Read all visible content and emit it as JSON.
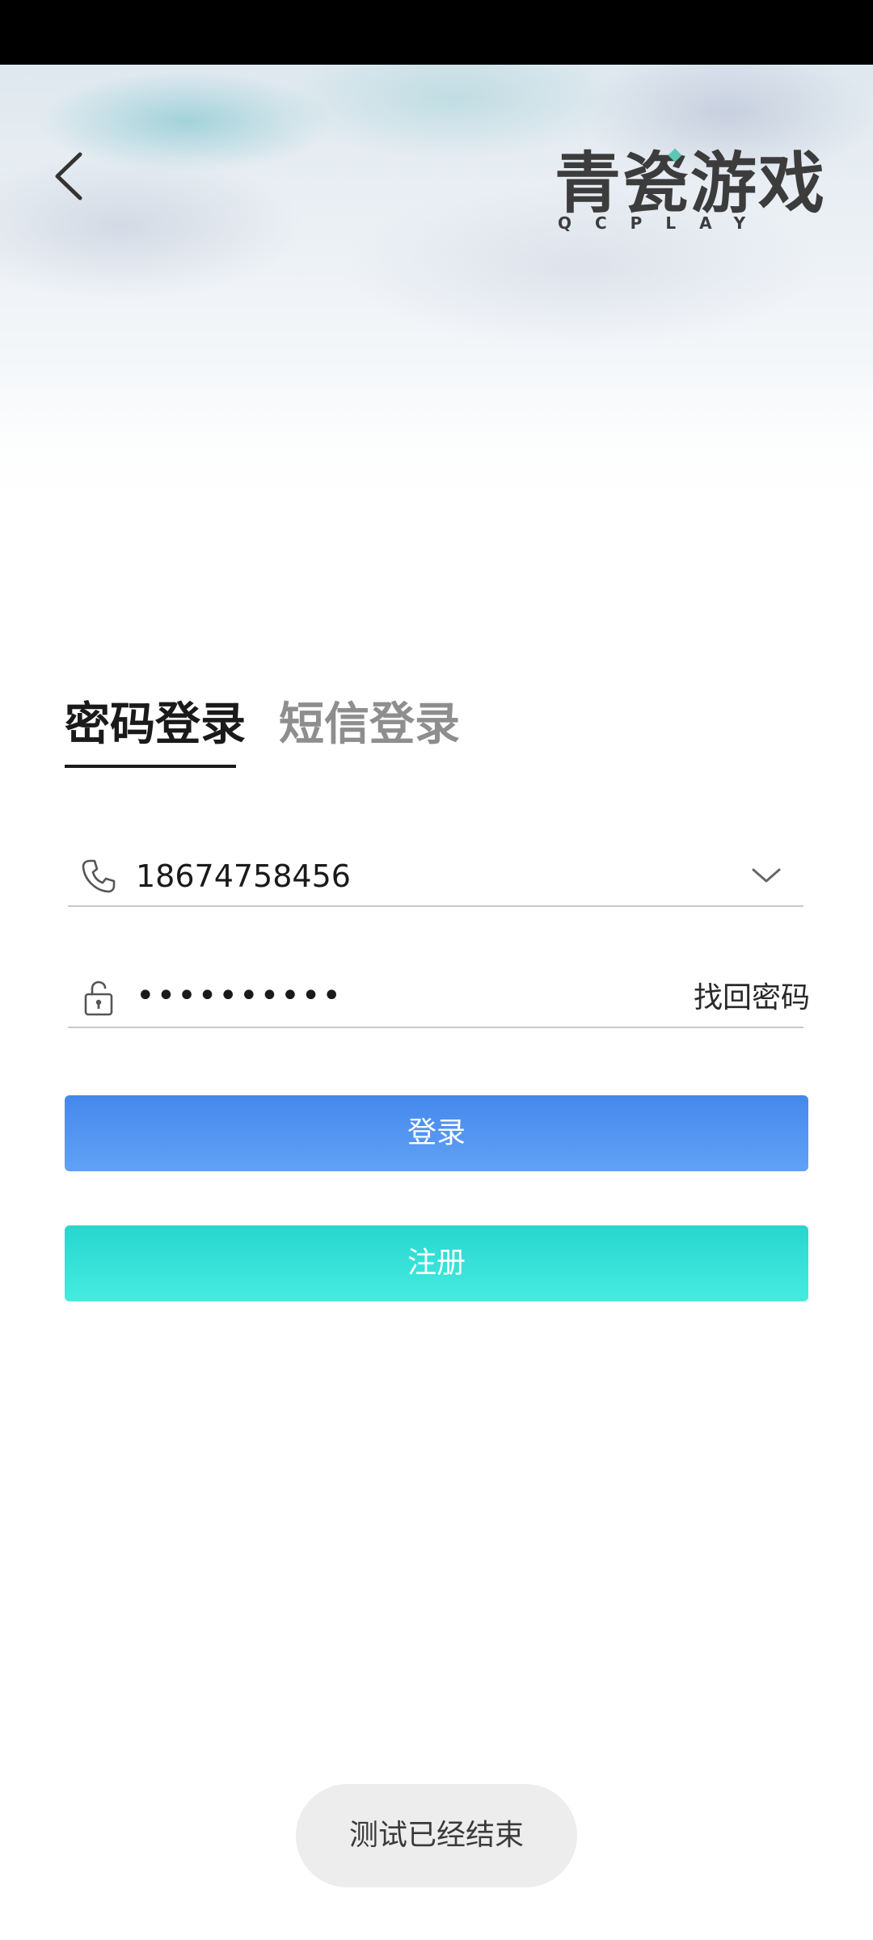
{
  "header": {
    "logo": {
      "text": "青瓷游戏",
      "subtext": "QCPLAY"
    }
  },
  "tabs": [
    {
      "label": "密码登录",
      "active": true
    },
    {
      "label": "短信登录",
      "active": false
    }
  ],
  "form": {
    "phone": {
      "value": "18674758456",
      "icon": "phone-icon",
      "dropdown_icon": "chevron-down-icon"
    },
    "password": {
      "masked_value": "••••••••••",
      "icon": "lock-icon",
      "forgot_label": "找回密码"
    }
  },
  "buttons": {
    "login_label": "登录",
    "register_label": "注册"
  },
  "toast": {
    "text": "测试已经结束"
  },
  "colors": {
    "login_button": "#4a8ced",
    "register_button": "#2fe0d6",
    "active_tab": "#1a1a1a",
    "inactive_tab": "#8e8e8e",
    "logo_accent": "#5cc8b4"
  }
}
